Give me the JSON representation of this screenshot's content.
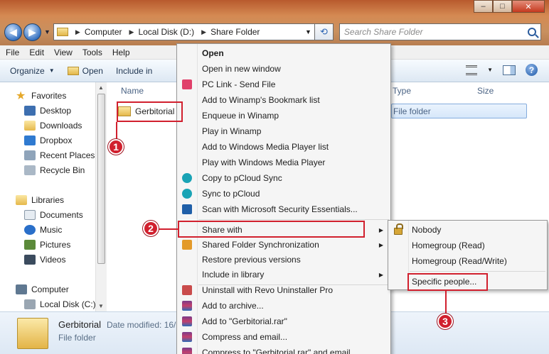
{
  "window": {
    "min": "–",
    "max": "□",
    "close": "✕"
  },
  "address": {
    "segments": [
      "Computer",
      "Local Disk (D:)",
      "Share Folder"
    ],
    "search_placeholder": "Search Share Folder"
  },
  "menubar": [
    "File",
    "Edit",
    "View",
    "Tools",
    "Help"
  ],
  "toolbar": {
    "organize": "Organize",
    "open": "Open",
    "include": "Include in"
  },
  "nav": {
    "favorites": "Favorites",
    "fav_items": [
      "Desktop",
      "Downloads",
      "Dropbox",
      "Recent Places",
      "Recycle Bin"
    ],
    "libraries": "Libraries",
    "lib_items": [
      "Documents",
      "Music",
      "Pictures",
      "Videos"
    ],
    "computer": "Computer",
    "comp_items": [
      "Local Disk (C:)"
    ]
  },
  "columns": {
    "name": "Name",
    "type": "Type",
    "size": "Size"
  },
  "file": {
    "name": "Gerbitorial",
    "type": "File folder"
  },
  "details": {
    "name": "Gerbitorial",
    "modified": "Date modified: 16/",
    "type": "File folder"
  },
  "context_menu": {
    "open": "Open",
    "open_new": "Open in new window",
    "pclink": "PC Link - Send File",
    "winamp_bookmark": "Add to Winamp's Bookmark list",
    "enqueue": "Enqueue in Winamp",
    "play_winamp": "Play in Winamp",
    "wmp_list": "Add to Windows Media Player list",
    "wmp_play": "Play with Windows Media Player",
    "pcloud_copy": "Copy to pCloud Sync",
    "pcloud_sync": "Sync to pCloud",
    "mse_scan": "Scan with Microsoft Security Essentials...",
    "share_with": "Share with",
    "shared_sync": "Shared Folder Synchronization",
    "restore": "Restore previous versions",
    "include_lib": "Include in library",
    "revo": "Uninstall with Revo Uninstaller Pro",
    "add_archive": "Add to archive...",
    "add_rar": "Add to \"Gerbitorial.rar\"",
    "compress_email": "Compress and email...",
    "compress_rar_email": "Compress to \"Gerbitorial.rar\" and email"
  },
  "share_submenu": {
    "nobody": "Nobody",
    "hg_read": "Homegroup (Read)",
    "hg_rw": "Homegroup (Read/Write)",
    "specific": "Specific people..."
  },
  "badges": {
    "one": "1",
    "two": "2",
    "three": "3"
  }
}
